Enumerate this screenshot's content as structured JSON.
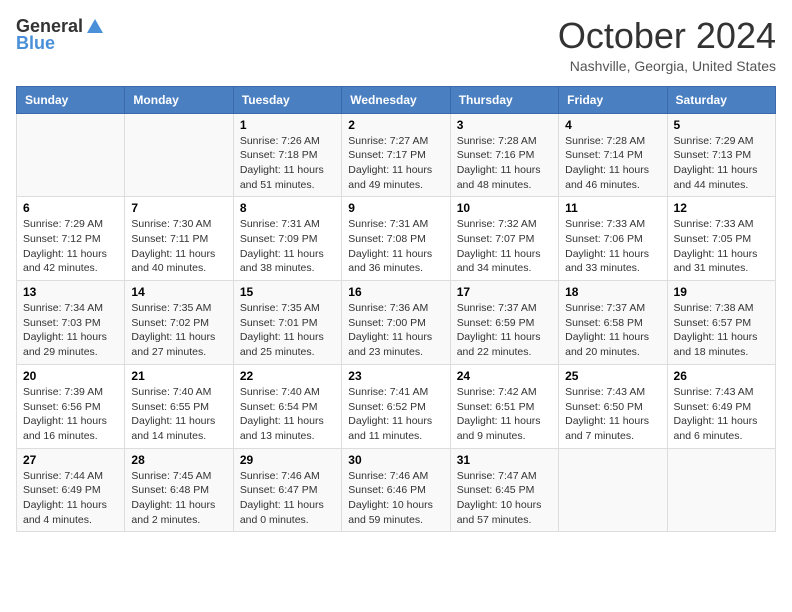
{
  "header": {
    "logo_general": "General",
    "logo_blue": "Blue",
    "month_title": "October 2024",
    "location": "Nashville, Georgia, United States"
  },
  "days_of_week": [
    "Sunday",
    "Monday",
    "Tuesday",
    "Wednesday",
    "Thursday",
    "Friday",
    "Saturday"
  ],
  "weeks": [
    [
      {
        "day": "",
        "info": ""
      },
      {
        "day": "",
        "info": ""
      },
      {
        "day": "1",
        "info": "Sunrise: 7:26 AM\nSunset: 7:18 PM\nDaylight: 11 hours and 51 minutes."
      },
      {
        "day": "2",
        "info": "Sunrise: 7:27 AM\nSunset: 7:17 PM\nDaylight: 11 hours and 49 minutes."
      },
      {
        "day": "3",
        "info": "Sunrise: 7:28 AM\nSunset: 7:16 PM\nDaylight: 11 hours and 48 minutes."
      },
      {
        "day": "4",
        "info": "Sunrise: 7:28 AM\nSunset: 7:14 PM\nDaylight: 11 hours and 46 minutes."
      },
      {
        "day": "5",
        "info": "Sunrise: 7:29 AM\nSunset: 7:13 PM\nDaylight: 11 hours and 44 minutes."
      }
    ],
    [
      {
        "day": "6",
        "info": "Sunrise: 7:29 AM\nSunset: 7:12 PM\nDaylight: 11 hours and 42 minutes."
      },
      {
        "day": "7",
        "info": "Sunrise: 7:30 AM\nSunset: 7:11 PM\nDaylight: 11 hours and 40 minutes."
      },
      {
        "day": "8",
        "info": "Sunrise: 7:31 AM\nSunset: 7:09 PM\nDaylight: 11 hours and 38 minutes."
      },
      {
        "day": "9",
        "info": "Sunrise: 7:31 AM\nSunset: 7:08 PM\nDaylight: 11 hours and 36 minutes."
      },
      {
        "day": "10",
        "info": "Sunrise: 7:32 AM\nSunset: 7:07 PM\nDaylight: 11 hours and 34 minutes."
      },
      {
        "day": "11",
        "info": "Sunrise: 7:33 AM\nSunset: 7:06 PM\nDaylight: 11 hours and 33 minutes."
      },
      {
        "day": "12",
        "info": "Sunrise: 7:33 AM\nSunset: 7:05 PM\nDaylight: 11 hours and 31 minutes."
      }
    ],
    [
      {
        "day": "13",
        "info": "Sunrise: 7:34 AM\nSunset: 7:03 PM\nDaylight: 11 hours and 29 minutes."
      },
      {
        "day": "14",
        "info": "Sunrise: 7:35 AM\nSunset: 7:02 PM\nDaylight: 11 hours and 27 minutes."
      },
      {
        "day": "15",
        "info": "Sunrise: 7:35 AM\nSunset: 7:01 PM\nDaylight: 11 hours and 25 minutes."
      },
      {
        "day": "16",
        "info": "Sunrise: 7:36 AM\nSunset: 7:00 PM\nDaylight: 11 hours and 23 minutes."
      },
      {
        "day": "17",
        "info": "Sunrise: 7:37 AM\nSunset: 6:59 PM\nDaylight: 11 hours and 22 minutes."
      },
      {
        "day": "18",
        "info": "Sunrise: 7:37 AM\nSunset: 6:58 PM\nDaylight: 11 hours and 20 minutes."
      },
      {
        "day": "19",
        "info": "Sunrise: 7:38 AM\nSunset: 6:57 PM\nDaylight: 11 hours and 18 minutes."
      }
    ],
    [
      {
        "day": "20",
        "info": "Sunrise: 7:39 AM\nSunset: 6:56 PM\nDaylight: 11 hours and 16 minutes."
      },
      {
        "day": "21",
        "info": "Sunrise: 7:40 AM\nSunset: 6:55 PM\nDaylight: 11 hours and 14 minutes."
      },
      {
        "day": "22",
        "info": "Sunrise: 7:40 AM\nSunset: 6:54 PM\nDaylight: 11 hours and 13 minutes."
      },
      {
        "day": "23",
        "info": "Sunrise: 7:41 AM\nSunset: 6:52 PM\nDaylight: 11 hours and 11 minutes."
      },
      {
        "day": "24",
        "info": "Sunrise: 7:42 AM\nSunset: 6:51 PM\nDaylight: 11 hours and 9 minutes."
      },
      {
        "day": "25",
        "info": "Sunrise: 7:43 AM\nSunset: 6:50 PM\nDaylight: 11 hours and 7 minutes."
      },
      {
        "day": "26",
        "info": "Sunrise: 7:43 AM\nSunset: 6:49 PM\nDaylight: 11 hours and 6 minutes."
      }
    ],
    [
      {
        "day": "27",
        "info": "Sunrise: 7:44 AM\nSunset: 6:49 PM\nDaylight: 11 hours and 4 minutes."
      },
      {
        "day": "28",
        "info": "Sunrise: 7:45 AM\nSunset: 6:48 PM\nDaylight: 11 hours and 2 minutes."
      },
      {
        "day": "29",
        "info": "Sunrise: 7:46 AM\nSunset: 6:47 PM\nDaylight: 11 hours and 0 minutes."
      },
      {
        "day": "30",
        "info": "Sunrise: 7:46 AM\nSunset: 6:46 PM\nDaylight: 10 hours and 59 minutes."
      },
      {
        "day": "31",
        "info": "Sunrise: 7:47 AM\nSunset: 6:45 PM\nDaylight: 10 hours and 57 minutes."
      },
      {
        "day": "",
        "info": ""
      },
      {
        "day": "",
        "info": ""
      }
    ]
  ]
}
